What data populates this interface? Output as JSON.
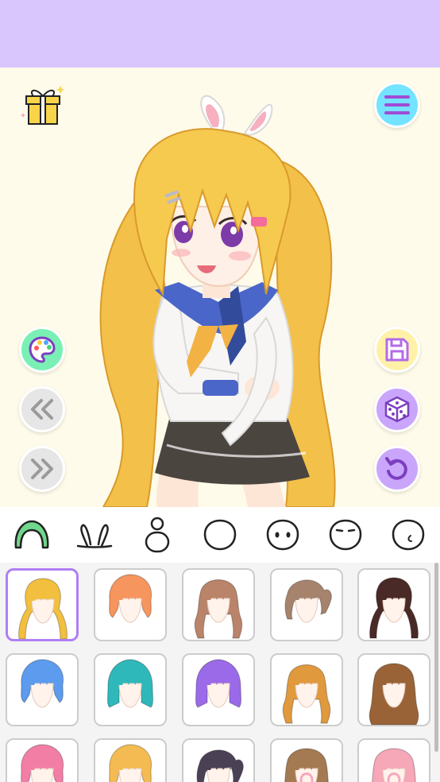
{
  "colors": {
    "topbar": "#d9c6fd",
    "background": "#fffbea",
    "accent": "#b07ff5",
    "menu_button": "#74e3ff",
    "palette_button": "#7af0b5",
    "save_button": "#fff2a8",
    "random_button": "#c9a6fb",
    "undo_button": "#c9a6fb",
    "nav_button": "#e6e6e6"
  },
  "toolbar": {
    "left": [
      {
        "name": "color-palette-button",
        "icon": "palette-icon"
      },
      {
        "name": "previous-button",
        "icon": "double-chevron-left-icon"
      },
      {
        "name": "next-button",
        "icon": "double-chevron-right-icon"
      }
    ],
    "right": [
      {
        "name": "save-button",
        "icon": "floppy-disk-icon"
      },
      {
        "name": "random-button",
        "icon": "dice-icon"
      },
      {
        "name": "undo-button",
        "icon": "undo-icon"
      }
    ]
  },
  "category_tabs": [
    {
      "name": "hair",
      "icon": "hair-icon",
      "selected": true
    },
    {
      "name": "accessory",
      "icon": "bunny-ears-icon",
      "selected": false
    },
    {
      "name": "body",
      "icon": "body-icon",
      "selected": false
    },
    {
      "name": "face",
      "icon": "face-icon",
      "selected": false
    },
    {
      "name": "eyes",
      "icon": "eyes-icon",
      "selected": false
    },
    {
      "name": "expression",
      "icon": "expression-icon",
      "selected": false
    },
    {
      "name": "mouth",
      "icon": "mouth-icon",
      "selected": false
    }
  ],
  "hair_options": [
    {
      "color": "#f2bf3e",
      "style": "twin-tails",
      "selected": true,
      "locked": false
    },
    {
      "color": "#f6955d",
      "style": "short",
      "selected": false,
      "locked": false
    },
    {
      "color": "#b9846a",
      "style": "braids",
      "selected": false,
      "locked": false
    },
    {
      "color": "#a6836d",
      "style": "side-ponytail",
      "selected": false,
      "locked": false
    },
    {
      "color": "#4a2a26",
      "style": "twin-tails",
      "selected": false,
      "locked": false
    },
    {
      "color": "#5d9bef",
      "style": "short",
      "selected": false,
      "locked": false
    },
    {
      "color": "#2fb8ba",
      "style": "bob",
      "selected": false,
      "locked": false
    },
    {
      "color": "#9a6ae8",
      "style": "bob",
      "selected": false,
      "locked": false
    },
    {
      "color": "#e1993e",
      "style": "pigtails",
      "selected": false,
      "locked": false
    },
    {
      "color": "#9a6337",
      "style": "wavy",
      "selected": false,
      "locked": false
    },
    {
      "color": "#f27ea6",
      "style": "short",
      "selected": false,
      "locked": false
    },
    {
      "color": "#f4bb52",
      "style": "short",
      "selected": false,
      "locked": false
    },
    {
      "color": "#4b4155",
      "style": "ponytail",
      "selected": false,
      "locked": false
    },
    {
      "color": "#a47a52",
      "style": "long",
      "selected": false,
      "locked": true
    },
    {
      "color": "#f6a7b8",
      "style": "long",
      "selected": false,
      "locked": true
    }
  ]
}
